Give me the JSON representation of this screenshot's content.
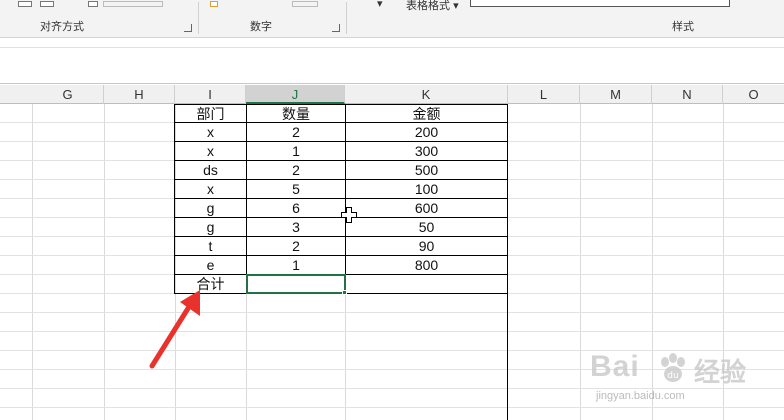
{
  "ribbon": {
    "groups": [
      {
        "label": "对齐方式"
      },
      {
        "label": "数字"
      },
      {
        "label": "样式"
      }
    ],
    "table_format_label": "表格格式",
    "dropdown_arrow": "▾"
  },
  "columns": [
    "G",
    "H",
    "I",
    "J",
    "K",
    "L",
    "M",
    "N",
    "O"
  ],
  "selected_column": "J",
  "table": {
    "header": {
      "dept": "部门",
      "qty": "数量",
      "amount": "金额"
    },
    "rows": [
      {
        "dept": "x",
        "qty": "2",
        "amount": "200"
      },
      {
        "dept": "x",
        "qty": "1",
        "amount": "300"
      },
      {
        "dept": "ds",
        "qty": "2",
        "amount": "500"
      },
      {
        "dept": "x",
        "qty": "5",
        "amount": "100"
      },
      {
        "dept": "g",
        "qty": "6",
        "amount": "600"
      },
      {
        "dept": "g",
        "qty": "3",
        "amount": "50"
      },
      {
        "dept": "t",
        "qty": "2",
        "amount": "90"
      },
      {
        "dept": "e",
        "qty": "1",
        "amount": "800"
      }
    ],
    "total_label": "合计",
    "total_qty": "",
    "total_amount": ""
  },
  "active_cell": "J11",
  "colors": {
    "selection": "#217346",
    "annotation_arrow": "#e8322b"
  },
  "watermark": {
    "text": "Bai",
    "text_cn": "经验",
    "url": "jingyan.baidu.com"
  }
}
